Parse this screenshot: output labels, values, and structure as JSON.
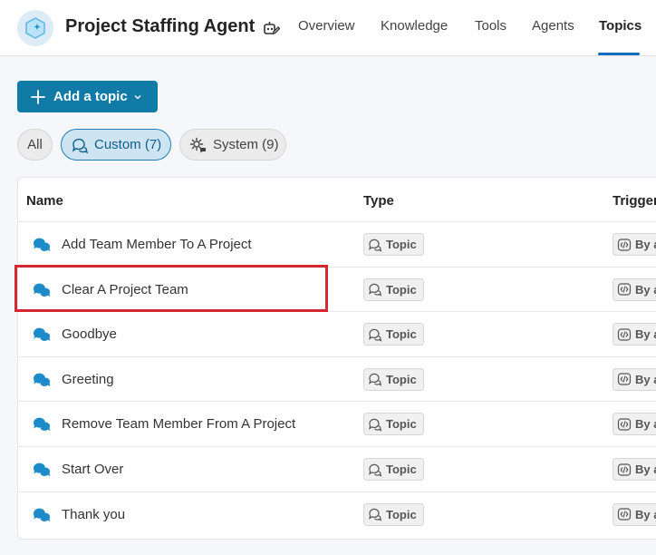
{
  "header": {
    "agent_title": "Project Staffing Agent",
    "logo_icon": "agent-sparkle-icon",
    "edit_icon": "agent-edit-icon",
    "tabs": [
      {
        "label": "Overview",
        "active": false
      },
      {
        "label": "Knowledge",
        "active": false
      },
      {
        "label": "Tools",
        "active": false
      },
      {
        "label": "Agents",
        "active": false
      },
      {
        "label": "Topics",
        "active": true
      }
    ]
  },
  "toolbar": {
    "add_topic_label": "Add a topic"
  },
  "filters": [
    {
      "label": "All",
      "active": false
    },
    {
      "label": "Custom (7)",
      "active": true
    },
    {
      "label": "System (9)",
      "active": false
    }
  ],
  "table": {
    "columns": [
      "Name",
      "Type",
      "Trigger"
    ],
    "rows": [
      {
        "name": "Add Team Member To A Project",
        "type": "Topic",
        "trigger": "By a"
      },
      {
        "name": "Clear A Project Team",
        "type": "Topic",
        "trigger": "By a"
      },
      {
        "name": "Goodbye",
        "type": "Topic",
        "trigger": "By a"
      },
      {
        "name": "Greeting",
        "type": "Topic",
        "trigger": "By a"
      },
      {
        "name": "Remove Team Member From A Project",
        "type": "Topic",
        "trigger": "By a"
      },
      {
        "name": "Start Over",
        "type": "Topic",
        "trigger": "By a"
      },
      {
        "name": "Thank you",
        "type": "Topic",
        "trigger": "By a"
      }
    ]
  },
  "colors": {
    "accent": "#107ba6",
    "highlight": "#d62630",
    "tab_underline": "#0f6cbd"
  }
}
